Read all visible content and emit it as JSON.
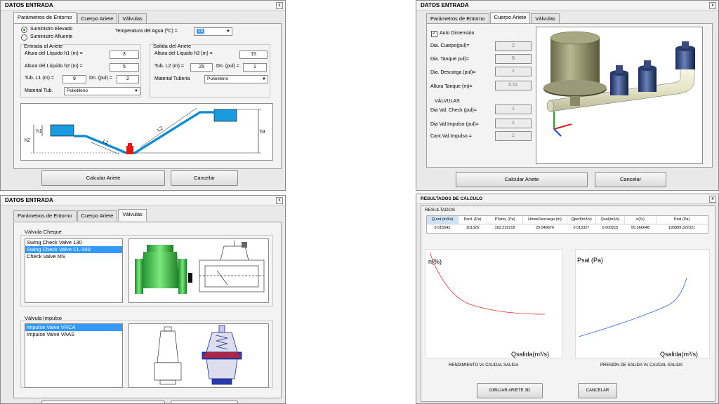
{
  "windows": {
    "entorno": {
      "title": "DATOS ENTRADA",
      "close": "x",
      "tabs": [
        "Parámetros de Entorno",
        "Cuerpo Ariete",
        "Válvulas"
      ],
      "supply_options": [
        "Suministro Elevado",
        "Suministro Afluente"
      ],
      "water_temp_label": "Temperatura del Agua (ºC) =",
      "water_temp_value": "25",
      "entrada": {
        "title": "Entrada al Ariete",
        "h1_label": "Altura del Líquido h1 (m) =",
        "h1_value": "3",
        "h2_label": "Altura del Líquido h2 (m) =",
        "h2_value": "5",
        "l1_label": "Tub. L1 (m) =",
        "l1_value": "9",
        "dn_label": "Dn. (pul) =",
        "dn_value": "2",
        "material_label": "Material Tub.",
        "material_value": "Polietileno"
      },
      "salida": {
        "title": "Salida del Ariete",
        "h3_label": "Altura del Líquido h3 (m) =",
        "h3_value": "15",
        "l2_label": "Tub. L2 (m) =",
        "l2_value": "25",
        "dn_label": "Dn. (pul) =",
        "dn_value": "1",
        "material_label": "Material Tubería",
        "material_value": "Polietileno"
      },
      "diagram_labels": {
        "h1": "h1",
        "h2": "h2",
        "h3": "h3",
        "l1": "L1",
        "l2": "L2"
      },
      "calc_button": "Calcular Ariete",
      "cancel_button": "Cancelar"
    },
    "cuerpo": {
      "title": "DATOS ENTRADA",
      "close": "x",
      "tabs": [
        "Parámetros de Entorno",
        "Cuerpo Ariete",
        "Válvulas"
      ],
      "auto_dim_label": "Auto Dimensión",
      "fields": [
        {
          "label": "Dia. Cuerpo(pul)=",
          "value": "2"
        },
        {
          "label": "Dia. Tanque pul)=",
          "value": "6"
        },
        {
          "label": "Dia. Descarga (pul)=",
          "value": "1"
        },
        {
          "label": "Altura Tanque (m)=",
          "value": "0.51"
        }
      ],
      "valves_title": "VÁLVULAS",
      "valve_fields": [
        {
          "label": "Dia Val. Check (pul)=",
          "value": "1"
        },
        {
          "label": "Dia Val.Impulso (pul)=",
          "value": "1"
        },
        {
          "label": "Cant.Val.Impulso =",
          "value": "1"
        }
      ],
      "calc_button": "Calcular Ariete",
      "cancel_button": "Cancelar"
    },
    "valvulas": {
      "title": "DATOS ENTRADA",
      "close": "x",
      "tabs": [
        "Parámetros de Entorno",
        "Cuerpo Ariete",
        "Válvulas"
      ],
      "check_title": "Válvula Cheque",
      "check_items": [
        "Swing Check Valve 130",
        "Swing Check Valve CL-300",
        "Check Valve MS"
      ],
      "impulse_title": "Válvula Impulso",
      "impulse_items": [
        "Impulse Valve VRCA",
        "Impulse Valve VAAS"
      ]
    },
    "resultados": {
      "title": "RESULTADOS DE CÁLCULO",
      "close": "x",
      "section": "RESULTADOS",
      "columns": [
        "Q.ent (m3/s)",
        "Perd. (Pa)",
        "PTanq. (Pa)",
        "HmaxDescarga (m)",
        "Qperf(m3/s)",
        "Qsal(m3/s)",
        "n(%)",
        "Psal (Pa)"
      ],
      "row": [
        "0.015542",
        "101325",
        "182.219218",
        "20.049876",
        "0.015327",
        "0.000215",
        "55.566648",
        "195899.322321"
      ],
      "chart_left": {
        "ylabel": "n(%)",
        "xlabel": "Qsalida(m³/s)",
        "caption": "RENDIMIENTO Vs CAUDAL SALIDA",
        "color": "#e03030"
      },
      "chart_right": {
        "ylabel": "Psal (Pa)",
        "xlabel": "Qsalida(m³/s)",
        "caption": "PRESIÓN DE SALIDA Vs CAUDAL SALIDA",
        "color": "#3366dd"
      },
      "draw_button": "DIBUJAR ARIETE 3D",
      "cancel_button": "CANCELAR"
    }
  }
}
